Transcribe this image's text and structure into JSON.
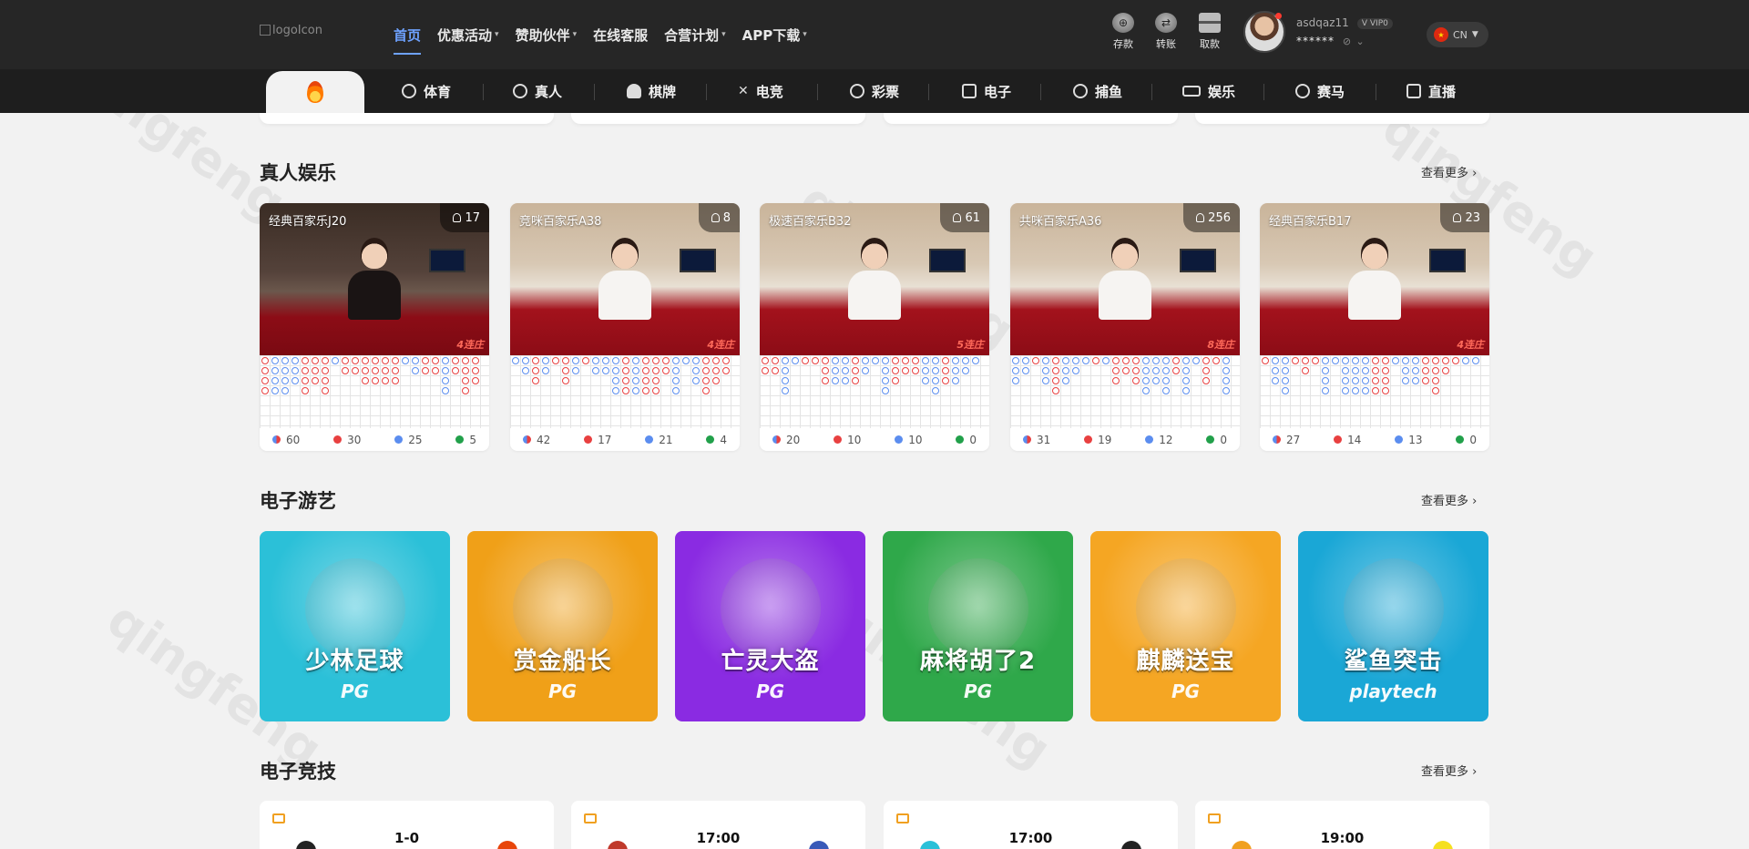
{
  "header": {
    "logo_alt": "logoIcon",
    "nav": [
      {
        "label": "首页",
        "active": true,
        "dropdown": false
      },
      {
        "label": "优惠活动",
        "active": false,
        "dropdown": true
      },
      {
        "label": "赞助伙伴",
        "active": false,
        "dropdown": true
      },
      {
        "label": "在线客服",
        "active": false,
        "dropdown": false
      },
      {
        "label": "合营计划",
        "active": false,
        "dropdown": true
      },
      {
        "label": "APP下载",
        "active": false,
        "dropdown": true
      }
    ],
    "wallet": [
      {
        "label": "存款",
        "icon": "deposit-icon"
      },
      {
        "label": "转账",
        "icon": "transfer-icon"
      },
      {
        "label": "取款",
        "icon": "withdraw-icon"
      }
    ],
    "user": {
      "username": "asdqaz11",
      "vip": "VIP0",
      "balance_masked": "******"
    },
    "language": "CN"
  },
  "categories": [
    {
      "label": "体育",
      "icon": "soccer-ball-icon"
    },
    {
      "label": "真人",
      "icon": "casino-chip-icon"
    },
    {
      "label": "棋牌",
      "icon": "spade-icon"
    },
    {
      "label": "电竞",
      "icon": "crossed-swords-icon"
    },
    {
      "label": "彩票",
      "icon": "lottery-ball-icon"
    },
    {
      "label": "电子",
      "icon": "slot-machine-icon"
    },
    {
      "label": "捕鱼",
      "icon": "fish-icon"
    },
    {
      "label": "娱乐",
      "icon": "ticket-icon"
    },
    {
      "label": "赛马",
      "icon": "horse-icon"
    },
    {
      "label": "直播",
      "icon": "play-icon"
    }
  ],
  "live_section": {
    "title": "真人娱乐",
    "more": "查看更多 ›",
    "tables": [
      {
        "name": "经典百家乐J20",
        "players": "17",
        "streak": "4连庄",
        "stats": [
          "60",
          "30",
          "25",
          "5"
        ]
      },
      {
        "name": "竞咪百家乐A38",
        "players": "8",
        "streak": "4连庄",
        "stats": [
          "42",
          "17",
          "21",
          "4"
        ]
      },
      {
        "name": "极速百家乐B32",
        "players": "61",
        "streak": "5连庄",
        "stats": [
          "20",
          "10",
          "10",
          "0"
        ]
      },
      {
        "name": "共咪百家乐A36",
        "players": "256",
        "streak": "8连庄",
        "stats": [
          "31",
          "19",
          "12",
          "0"
        ]
      },
      {
        "name": "经典百家乐B17",
        "players": "23",
        "streak": "4连庄",
        "stats": [
          "27",
          "14",
          "13",
          "0"
        ]
      }
    ]
  },
  "slots_section": {
    "title": "电子游艺",
    "more": "查看更多 ›",
    "games": [
      {
        "title": "少林足球",
        "provider": "PG",
        "color": "#2bc0d8"
      },
      {
        "title": "赏金船长",
        "provider": "PG",
        "color": "#f0a018"
      },
      {
        "title": "亡灵大盗",
        "provider": "PG",
        "color": "#8a2be2"
      },
      {
        "title": "麻将胡了2",
        "provider": "PG",
        "color": "#2fa84a"
      },
      {
        "title": "麒麟送宝",
        "provider": "PG",
        "color": "#f5a623"
      },
      {
        "title": "鲨鱼突击",
        "provider": "playtech",
        "color": "#1aa7d6"
      }
    ]
  },
  "esports_section": {
    "title": "电子竞技",
    "more": "查看更多 ›",
    "matches": [
      {
        "score": "1-0"
      },
      {
        "score": "17:00"
      },
      {
        "score": "17:00"
      },
      {
        "score": "19:00"
      }
    ]
  },
  "colors": {
    "accent": "#6ea2ff",
    "banker": "#e84040",
    "player": "#5b8def",
    "tie": "#21a04a"
  }
}
